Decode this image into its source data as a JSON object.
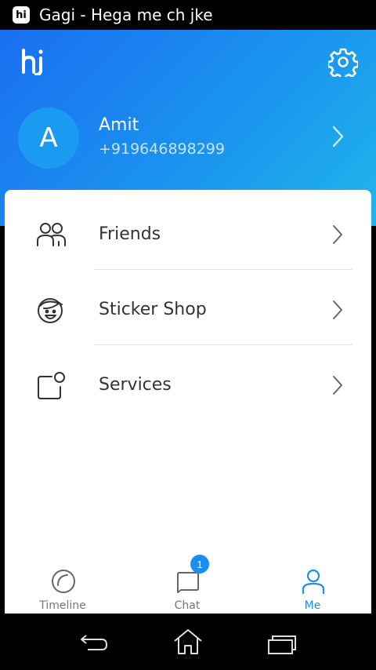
{
  "status_bar": {
    "app_icon": "hike-logo-icon",
    "app_icon_text": "hi",
    "ticker": "Gagi - Hega me ch jke"
  },
  "header": {
    "logo": "hi",
    "settings_icon": "gear-icon",
    "colors": {
      "gradient_start": "#1a6ff0",
      "gradient_end": "#21b6ea",
      "avatar_bg": "#1a9af0"
    }
  },
  "profile": {
    "initial": "A",
    "name": "Amit",
    "phone": "+919646898299"
  },
  "menu": [
    {
      "label": "Friends",
      "icon": "friends-icon"
    },
    {
      "label": "Sticker Shop",
      "icon": "sticker-face-icon"
    },
    {
      "label": "Services",
      "icon": "services-icon"
    }
  ],
  "bottom_nav": {
    "tabs": [
      {
        "label": "Timeline",
        "icon": "timeline-icon",
        "active": false
      },
      {
        "label": "Chat",
        "icon": "chat-icon",
        "active": false,
        "badge": "1"
      },
      {
        "label": "Me",
        "icon": "person-icon",
        "active": true
      }
    ],
    "accent": "#1b8ff0"
  },
  "system_nav": [
    "back-icon",
    "home-icon",
    "recents-icon"
  ]
}
